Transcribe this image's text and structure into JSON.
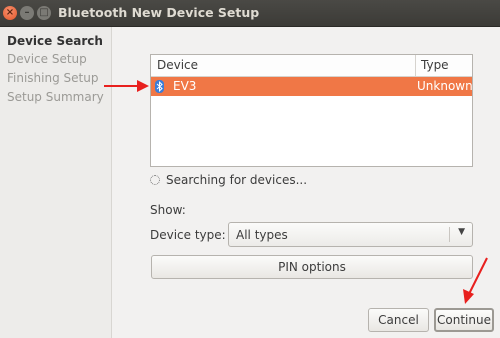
{
  "window": {
    "title": "Bluetooth New Device Setup",
    "close_glyph": "×",
    "min_glyph": "–",
    "max_glyph": "□"
  },
  "sidebar": {
    "items": [
      {
        "label": "Device Search",
        "active": true
      },
      {
        "label": "Device Setup",
        "active": false
      },
      {
        "label": "Finishing Setup",
        "active": false
      },
      {
        "label": "Setup Summary",
        "active": false
      }
    ]
  },
  "device_list": {
    "columns": [
      "Device",
      "Type"
    ],
    "rows": [
      {
        "device": "EV3",
        "type": "Unknown",
        "icon": "bluetooth-icon",
        "selected": true
      }
    ]
  },
  "status": {
    "searching": "Searching for devices..."
  },
  "filter": {
    "show_label": "Show:",
    "device_type_label": "Device type:",
    "device_type_value": "All types"
  },
  "buttons": {
    "pin_options": "PIN options",
    "cancel": "Cancel",
    "continue": "Continue"
  },
  "colors": {
    "selection": "#f07746",
    "annotation_arrow": "#e8201e",
    "titlebar": "#3c3b37"
  }
}
